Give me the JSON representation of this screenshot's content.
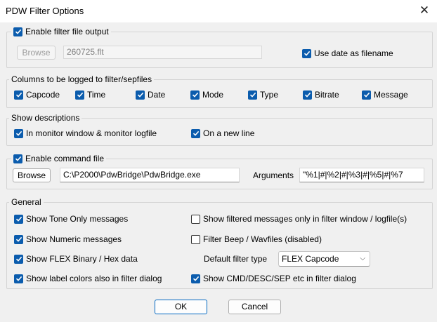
{
  "window": {
    "title": "PDW Filter Options",
    "close_glyph": "✕"
  },
  "filter_output": {
    "label": "Enable filter file output",
    "checked": true,
    "browse_label": "Browse",
    "filename": "260725.flt",
    "use_date_label": "Use date as filename",
    "use_date_checked": true
  },
  "columns": {
    "legend": "Columns to be logged to filter/sepfiles",
    "items": [
      {
        "label": "Capcode",
        "checked": true
      },
      {
        "label": "Time",
        "checked": true
      },
      {
        "label": "Date",
        "checked": true
      },
      {
        "label": "Mode",
        "checked": true
      },
      {
        "label": "Type",
        "checked": true
      },
      {
        "label": "Bitrate",
        "checked": true
      },
      {
        "label": "Message",
        "checked": true
      }
    ]
  },
  "descriptions": {
    "legend": "Show descriptions",
    "monitor_label": "In monitor window & monitor logfile",
    "monitor_checked": true,
    "newline_label": "On a new line",
    "newline_checked": true
  },
  "command": {
    "label": "Enable command file",
    "checked": true,
    "browse_label": "Browse",
    "path": "C:\\P2000\\PdwBridge\\PdwBridge.exe",
    "arguments_label": "Arguments",
    "arguments": "\"%1|#|%2|#|%3|#|%5|#|%7"
  },
  "general": {
    "legend": "General",
    "tone_only": {
      "label": "Show Tone Only messages",
      "checked": true
    },
    "numeric": {
      "label": "Show Numeric messages",
      "checked": true
    },
    "flex_binary": {
      "label": "Show FLEX Binary / Hex data",
      "checked": true
    },
    "label_colors": {
      "label": "Show label colors also in filter dialog",
      "checked": true
    },
    "filtered_only": {
      "label": "Show filtered messages only in filter window / logfile(s)",
      "checked": false
    },
    "filter_beep": {
      "label": "Filter Beep / Wavfiles (disabled)",
      "checked": false
    },
    "default_type_label": "Default filter type",
    "default_type_value": "FLEX Capcode",
    "cmd_desc": {
      "label": "Show CMD/DESC/SEP etc in filter dialog",
      "checked": true
    }
  },
  "buttons": {
    "ok": "OK",
    "cancel": "Cancel"
  },
  "colors": {
    "accent": "#0b5cad",
    "background": "#f0f0f0"
  }
}
